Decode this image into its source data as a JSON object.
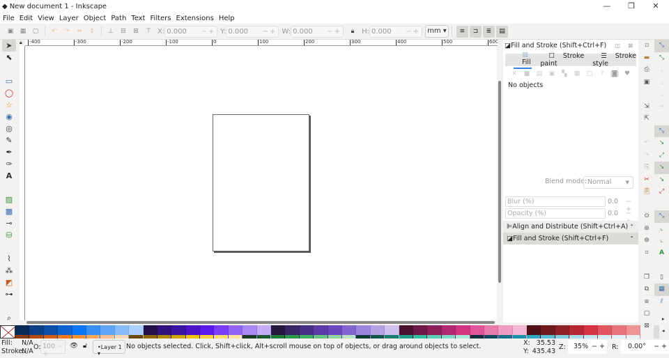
{
  "window": {
    "title": "New document 1 - Inkscape",
    "minimize": "—",
    "restore": "❐",
    "close": "✕"
  },
  "menu": [
    "File",
    "Edit",
    "View",
    "Layer",
    "Object",
    "Path",
    "Text",
    "Filters",
    "Extensions",
    "Help"
  ],
  "toolbar": {
    "x_label": "X:",
    "x_value": "0.000",
    "y_label": "Y:",
    "y_value": "0.000",
    "w_label": "W:",
    "w_value": "0.000",
    "h_label": "H:",
    "h_value": "0.000",
    "unit": "mm ▾"
  },
  "ruler": {
    "top_labels": [
      "-400",
      "-300",
      "-200",
      "-100",
      "0",
      "100",
      "200",
      "300",
      "400",
      "500",
      "600"
    ]
  },
  "dock": {
    "title": "Fill and Stroke (Shift+Ctrl+F)",
    "tabs": [
      "Fill",
      "Stroke paint",
      "Stroke style"
    ],
    "no_objects": "No objects",
    "blend_label": "Blend mode:",
    "blend_value": "Normal",
    "blur_label": "Blur (%)",
    "blur_value": "0.0",
    "opacity_label": "Opacity (%)",
    "opacity_value": "0.0",
    "align_panel": "Align and Distribute (Shift+Ctrl+A)",
    "fill_panel": "Fill and Stroke (Shift+Ctrl+F)"
  },
  "palette": {
    "top": [
      "#0a2a55",
      "#0d3f86",
      "#0b4ea8",
      "#0d63cf",
      "#0a76f5",
      "#3890f7",
      "#5fa6f7",
      "#86bafa",
      "#aacffd",
      "#241049",
      "#2e117d",
      "#3a13a5",
      "#4a14c8",
      "#5a18ee",
      "#7a3cf6",
      "#9264f7",
      "#a988f2",
      "#c4acf6",
      "#25193f",
      "#372765",
      "#452f85",
      "#5a3aa7",
      "#6c48c0",
      "#8265d0",
      "#9a86de",
      "#b2a2e2",
      "#cdbfee",
      "#4a1030",
      "#6e1848",
      "#8c1f5a",
      "#b0286e",
      "#d2357f",
      "#e0559a",
      "#e67aaa",
      "#ee9dc1",
      "#f2b7d2",
      "#4f1016",
      "#6e1a1e",
      "#8e2028",
      "#b52833",
      "#d63341",
      "#e15661",
      "#e7737c",
      "#ee9396"
    ],
    "bottom": [
      "#8a3c0a",
      "#b04d0c",
      "#d0600f",
      "#f07818",
      "#f89038",
      "#faa860",
      "#fcc090",
      "#fdd8b8",
      "#6a4a00",
      "#8a6a00",
      "#b08a00",
      "#d0a800",
      "#f0c400",
      "#f8d040",
      "#fadc70",
      "#fce6a0",
      "#183a20",
      "#1a5a2c",
      "#1e7a38",
      "#289a48",
      "#40b060",
      "#68c480",
      "#90d4a0",
      "#b8e4c0",
      "#0a3a30",
      "#10584a",
      "#168070",
      "#20a088",
      "#30c0a0",
      "#58d0b8",
      "#80dcc8",
      "#a8e8d8",
      "#0a3040",
      "#0c4a60",
      "#10708a",
      "#1890aa",
      "#30a8c4",
      "#58bcd4",
      "#80cce0",
      "#a8dcec",
      "#c0e4f0",
      "#d8eef6",
      "#e0f0f8",
      "#e8f4fa"
    ]
  },
  "status": {
    "fill_label": "Fill:",
    "fill_value": "N/A",
    "stroke_label": "Stroke:",
    "stroke_value": "N/A",
    "opacity_label": "O:",
    "opacity_value": "100",
    "layer": "•Layer 1 ▾",
    "message": "No objects selected. Click, Shift+click, Alt+scroll mouse on top of objects, or drag around objects to select.",
    "x_label": "X:",
    "x_value": "35.53",
    "y_label": "Y:",
    "y_value": "435.43",
    "zoom_label": "Z:",
    "zoom_value": "35%",
    "rotate_label": "R:",
    "rotate_value": "0.00°"
  }
}
